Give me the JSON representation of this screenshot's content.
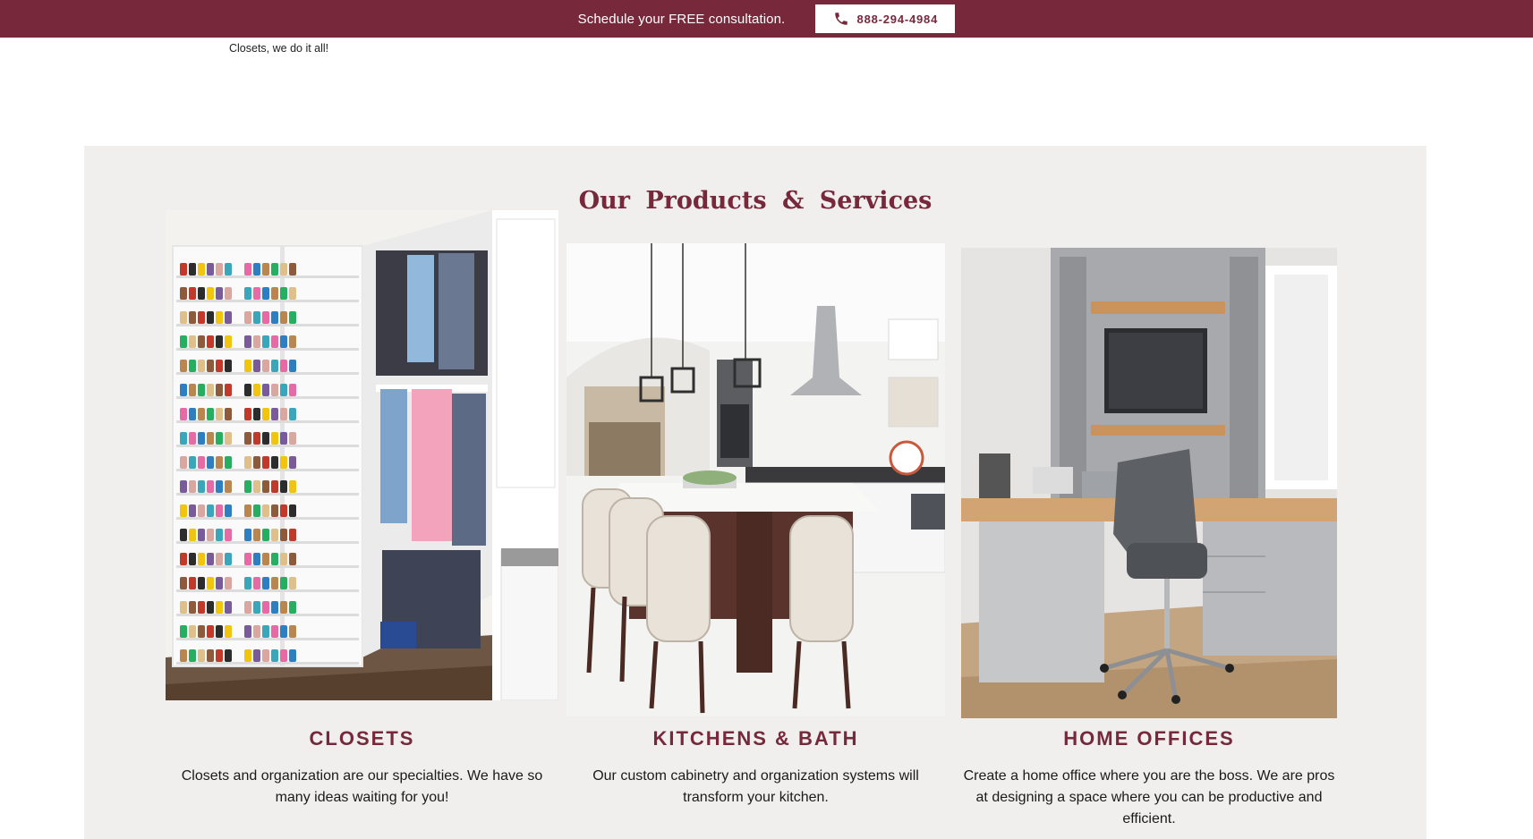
{
  "topbar": {
    "cta_text": "Schedule your FREE consultation.",
    "phone_label": "888-294-4984",
    "phone_icon": "phone-icon",
    "background_color": "#77283b"
  },
  "intro": {
    "text_tail": "Closets, we do it all!"
  },
  "products": {
    "title": "Our Products & Services",
    "items": [
      {
        "name": "CLOSETS",
        "description": "Closets and organization are our specialties. We have so many ideas waiting for you!",
        "image": "closet-photo"
      },
      {
        "name": "KITCHENS & BATH",
        "description": "Our custom cabinetry and organization systems will transform your kitchen.",
        "image": "kitchen-photo"
      },
      {
        "name": "HOME OFFICES",
        "description": "Create a home office where you are the boss. We are pros at designing a space where you can be productive and efficient.",
        "image": "home-office-photo"
      }
    ]
  },
  "colors": {
    "brand": "#77283b",
    "section_bg": "#f0efee"
  }
}
